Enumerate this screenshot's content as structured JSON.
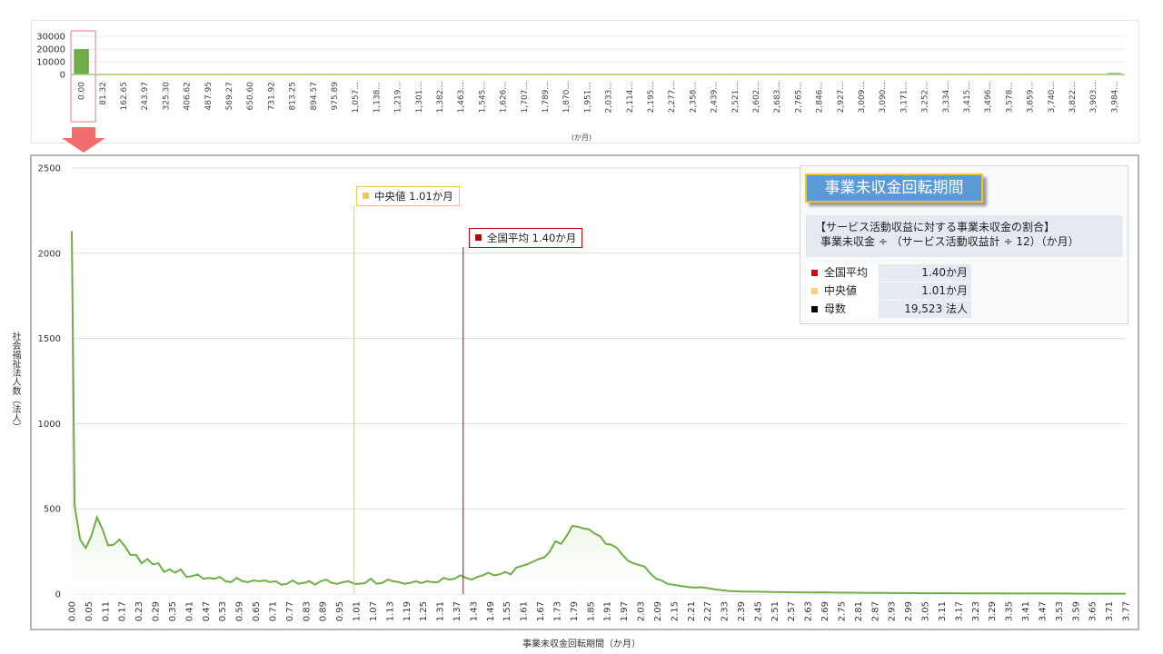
{
  "colors": {
    "series_line": "#70ad47",
    "series_fill": "#a9d18e",
    "mean": "#c00000",
    "median": "#f2c84b",
    "count": "#000000",
    "title_bg": "#5b9bd5",
    "title_border": "#f2c131",
    "highlight_box": "#f4a6a6",
    "arrow": "#f26d6d"
  },
  "icons": {
    "arrow": "down-arrow-icon",
    "mean_marker": "square-icon",
    "median_marker": "square-icon",
    "count_marker": "square-icon"
  },
  "chart_data": [
    {
      "type": "bar",
      "title": "",
      "xlabel": "(か月)",
      "ylabel": "",
      "ylim": [
        0,
        30000
      ],
      "yticks": [
        "30000",
        "20000",
        "10000",
        "0"
      ],
      "categories": [
        "0.00",
        "81.32",
        "162.65",
        "243.97",
        "325.30",
        "406.62",
        "487.95",
        "569.27",
        "650.60",
        "731.92",
        "813.25",
        "894.57",
        "975.89",
        "1,057...",
        "1,138...",
        "1,219...",
        "1,301...",
        "1,382...",
        "1,463...",
        "1,545...",
        "1,626...",
        "1,707...",
        "1,789...",
        "1,870...",
        "1,951...",
        "2,033...",
        "2,114...",
        "2,195...",
        "2,277...",
        "2,358...",
        "2,439...",
        "2,521...",
        "2,602...",
        "2,683...",
        "2,765...",
        "2,846...",
        "2,927...",
        "3,009...",
        "3,090...",
        "3,171...",
        "3,252...",
        "3,334...",
        "3,415...",
        "3,496...",
        "3,578...",
        "3,659...",
        "3,740...",
        "3,822...",
        "3,903...",
        "3,984..."
      ],
      "values": [
        19480,
        28,
        5,
        3,
        2,
        1,
        1,
        1,
        0,
        1,
        0,
        0,
        0,
        0,
        0,
        0,
        0,
        0,
        0,
        0,
        0,
        0,
        0,
        0,
        0,
        0,
        0,
        0,
        0,
        0,
        0,
        0,
        0,
        0,
        0,
        0,
        0,
        0,
        0,
        0,
        0,
        0,
        0,
        0,
        0,
        0,
        0,
        0,
        0,
        1500
      ],
      "highlighted_category": "0.00",
      "grid": true
    },
    {
      "type": "area",
      "title": "",
      "xlabel": "事業未収金回転期間（か月）",
      "ylabel": "社会福祉法人数（法人）",
      "ylim": [
        0,
        2500
      ],
      "yticks": [
        "0",
        "500",
        "1000",
        "1500",
        "2000",
        "2500"
      ],
      "grid": true,
      "xlim": [
        0,
        3.77
      ],
      "x_tick_labels": [
        "0.00",
        "0.05",
        "0.11",
        "0.17",
        "0.23",
        "0.29",
        "0.35",
        "0.41",
        "0.47",
        "0.53",
        "0.59",
        "0.65",
        "0.71",
        "0.77",
        "0.83",
        "0.89",
        "0.95",
        "1.01",
        "1.07",
        "1.13",
        "1.19",
        "1.25",
        "1.31",
        "1.37",
        "1.43",
        "1.49",
        "1.55",
        "1.61",
        "1.67",
        "1.73",
        "1.79",
        "1.85",
        "1.91",
        "1.97",
        "2.03",
        "2.09",
        "2.15",
        "2.21",
        "2.27",
        "2.33",
        "2.39",
        "2.45",
        "2.51",
        "2.57",
        "2.63",
        "2.69",
        "2.75",
        "2.81",
        "2.87",
        "2.93",
        "2.99",
        "3.05",
        "3.11",
        "3.17",
        "3.23",
        "3.29",
        "3.35",
        "3.41",
        "3.47",
        "3.53",
        "3.59",
        "3.65",
        "3.71",
        "3.77"
      ],
      "x": [
        0.0,
        0.01,
        0.03,
        0.05,
        0.07,
        0.09,
        0.11,
        0.13,
        0.15,
        0.17,
        0.19,
        0.21,
        0.23,
        0.25,
        0.27,
        0.29,
        0.31,
        0.33,
        0.35,
        0.37,
        0.39,
        0.41,
        0.43,
        0.45,
        0.47,
        0.49,
        0.51,
        0.53,
        0.55,
        0.57,
        0.59,
        0.61,
        0.63,
        0.65,
        0.67,
        0.69,
        0.71,
        0.73,
        0.75,
        0.77,
        0.79,
        0.81,
        0.83,
        0.85,
        0.87,
        0.89,
        0.91,
        0.93,
        0.95,
        0.97,
        0.99,
        1.01,
        1.03,
        1.05,
        1.07,
        1.09,
        1.11,
        1.13,
        1.15,
        1.17,
        1.19,
        1.21,
        1.23,
        1.25,
        1.27,
        1.29,
        1.31,
        1.33,
        1.35,
        1.37,
        1.39,
        1.41,
        1.43,
        1.45,
        1.47,
        1.49,
        1.51,
        1.53,
        1.55,
        1.57,
        1.59,
        1.61,
        1.63,
        1.65,
        1.67,
        1.69,
        1.71,
        1.73,
        1.75,
        1.77,
        1.79,
        1.81,
        1.83,
        1.85,
        1.87,
        1.89,
        1.91,
        1.93,
        1.95,
        1.97,
        1.99,
        2.01,
        2.03,
        2.05,
        2.07,
        2.09,
        2.11,
        2.13,
        2.15,
        2.17,
        2.19,
        2.21,
        2.23,
        2.25,
        2.27,
        2.29,
        2.31,
        2.33,
        2.35,
        2.4,
        2.45,
        2.5,
        2.55,
        2.6,
        2.65,
        2.7,
        2.75,
        2.8,
        2.85,
        2.9,
        2.95,
        3.0,
        3.05,
        3.1,
        3.15,
        3.2,
        3.25,
        3.3,
        3.35,
        3.4,
        3.45,
        3.5,
        3.55,
        3.6,
        3.65,
        3.7,
        3.77
      ],
      "values": [
        2130,
        520,
        320,
        270,
        340,
        450,
        380,
        285,
        290,
        320,
        280,
        230,
        230,
        180,
        205,
        175,
        180,
        130,
        145,
        125,
        145,
        100,
        105,
        115,
        90,
        95,
        90,
        100,
        75,
        70,
        95,
        75,
        70,
        80,
        75,
        80,
        70,
        75,
        55,
        60,
        80,
        60,
        65,
        75,
        55,
        75,
        85,
        65,
        60,
        70,
        75,
        60,
        60,
        65,
        90,
        60,
        65,
        85,
        75,
        70,
        60,
        65,
        75,
        65,
        75,
        70,
        70,
        95,
        85,
        90,
        110,
        95,
        85,
        100,
        110,
        125,
        110,
        115,
        130,
        115,
        155,
        165,
        175,
        190,
        205,
        215,
        250,
        310,
        295,
        340,
        400,
        395,
        385,
        380,
        355,
        340,
        295,
        290,
        270,
        230,
        195,
        180,
        170,
        160,
        120,
        90,
        80,
        60,
        55,
        50,
        45,
        40,
        38,
        40,
        35,
        30,
        25,
        22,
        18,
        15,
        14,
        12,
        11,
        10,
        9,
        10,
        8,
        8,
        7,
        7,
        6,
        6,
        5,
        5,
        5,
        4,
        4,
        4,
        3,
        3,
        3,
        3,
        3,
        2,
        2,
        2,
        2,
        2
      ],
      "reference_lines": [
        {
          "name": "中央値",
          "x": 1.01,
          "label": "中央値  1.01か月"
        },
        {
          "name": "全国平均",
          "x": 1.4,
          "label": "全国平均  1.40か月"
        }
      ]
    }
  ],
  "top_chart": {
    "xlabel": "(か月)"
  },
  "main_chart": {
    "xlabel": "事業未収金回転期間（か月）",
    "ylabel": "社会福祉法人数（法人）",
    "median_label": "中央値  1.01か月",
    "mean_label": "全国平均  1.40か月"
  },
  "info": {
    "title": "事業未収金回転期間",
    "formula_line1": "【サービス活動収益に対する事業未収金の割合】",
    "formula_line2": "事業未収金  ÷  （サービス活動収益計  ÷  12）（か月）",
    "rows": [
      {
        "label": "全国平均",
        "value": "1.40か月"
      },
      {
        "label": "中央値",
        "value": "1.01か月"
      },
      {
        "label": "母数",
        "value": "19,523  法人"
      }
    ]
  }
}
